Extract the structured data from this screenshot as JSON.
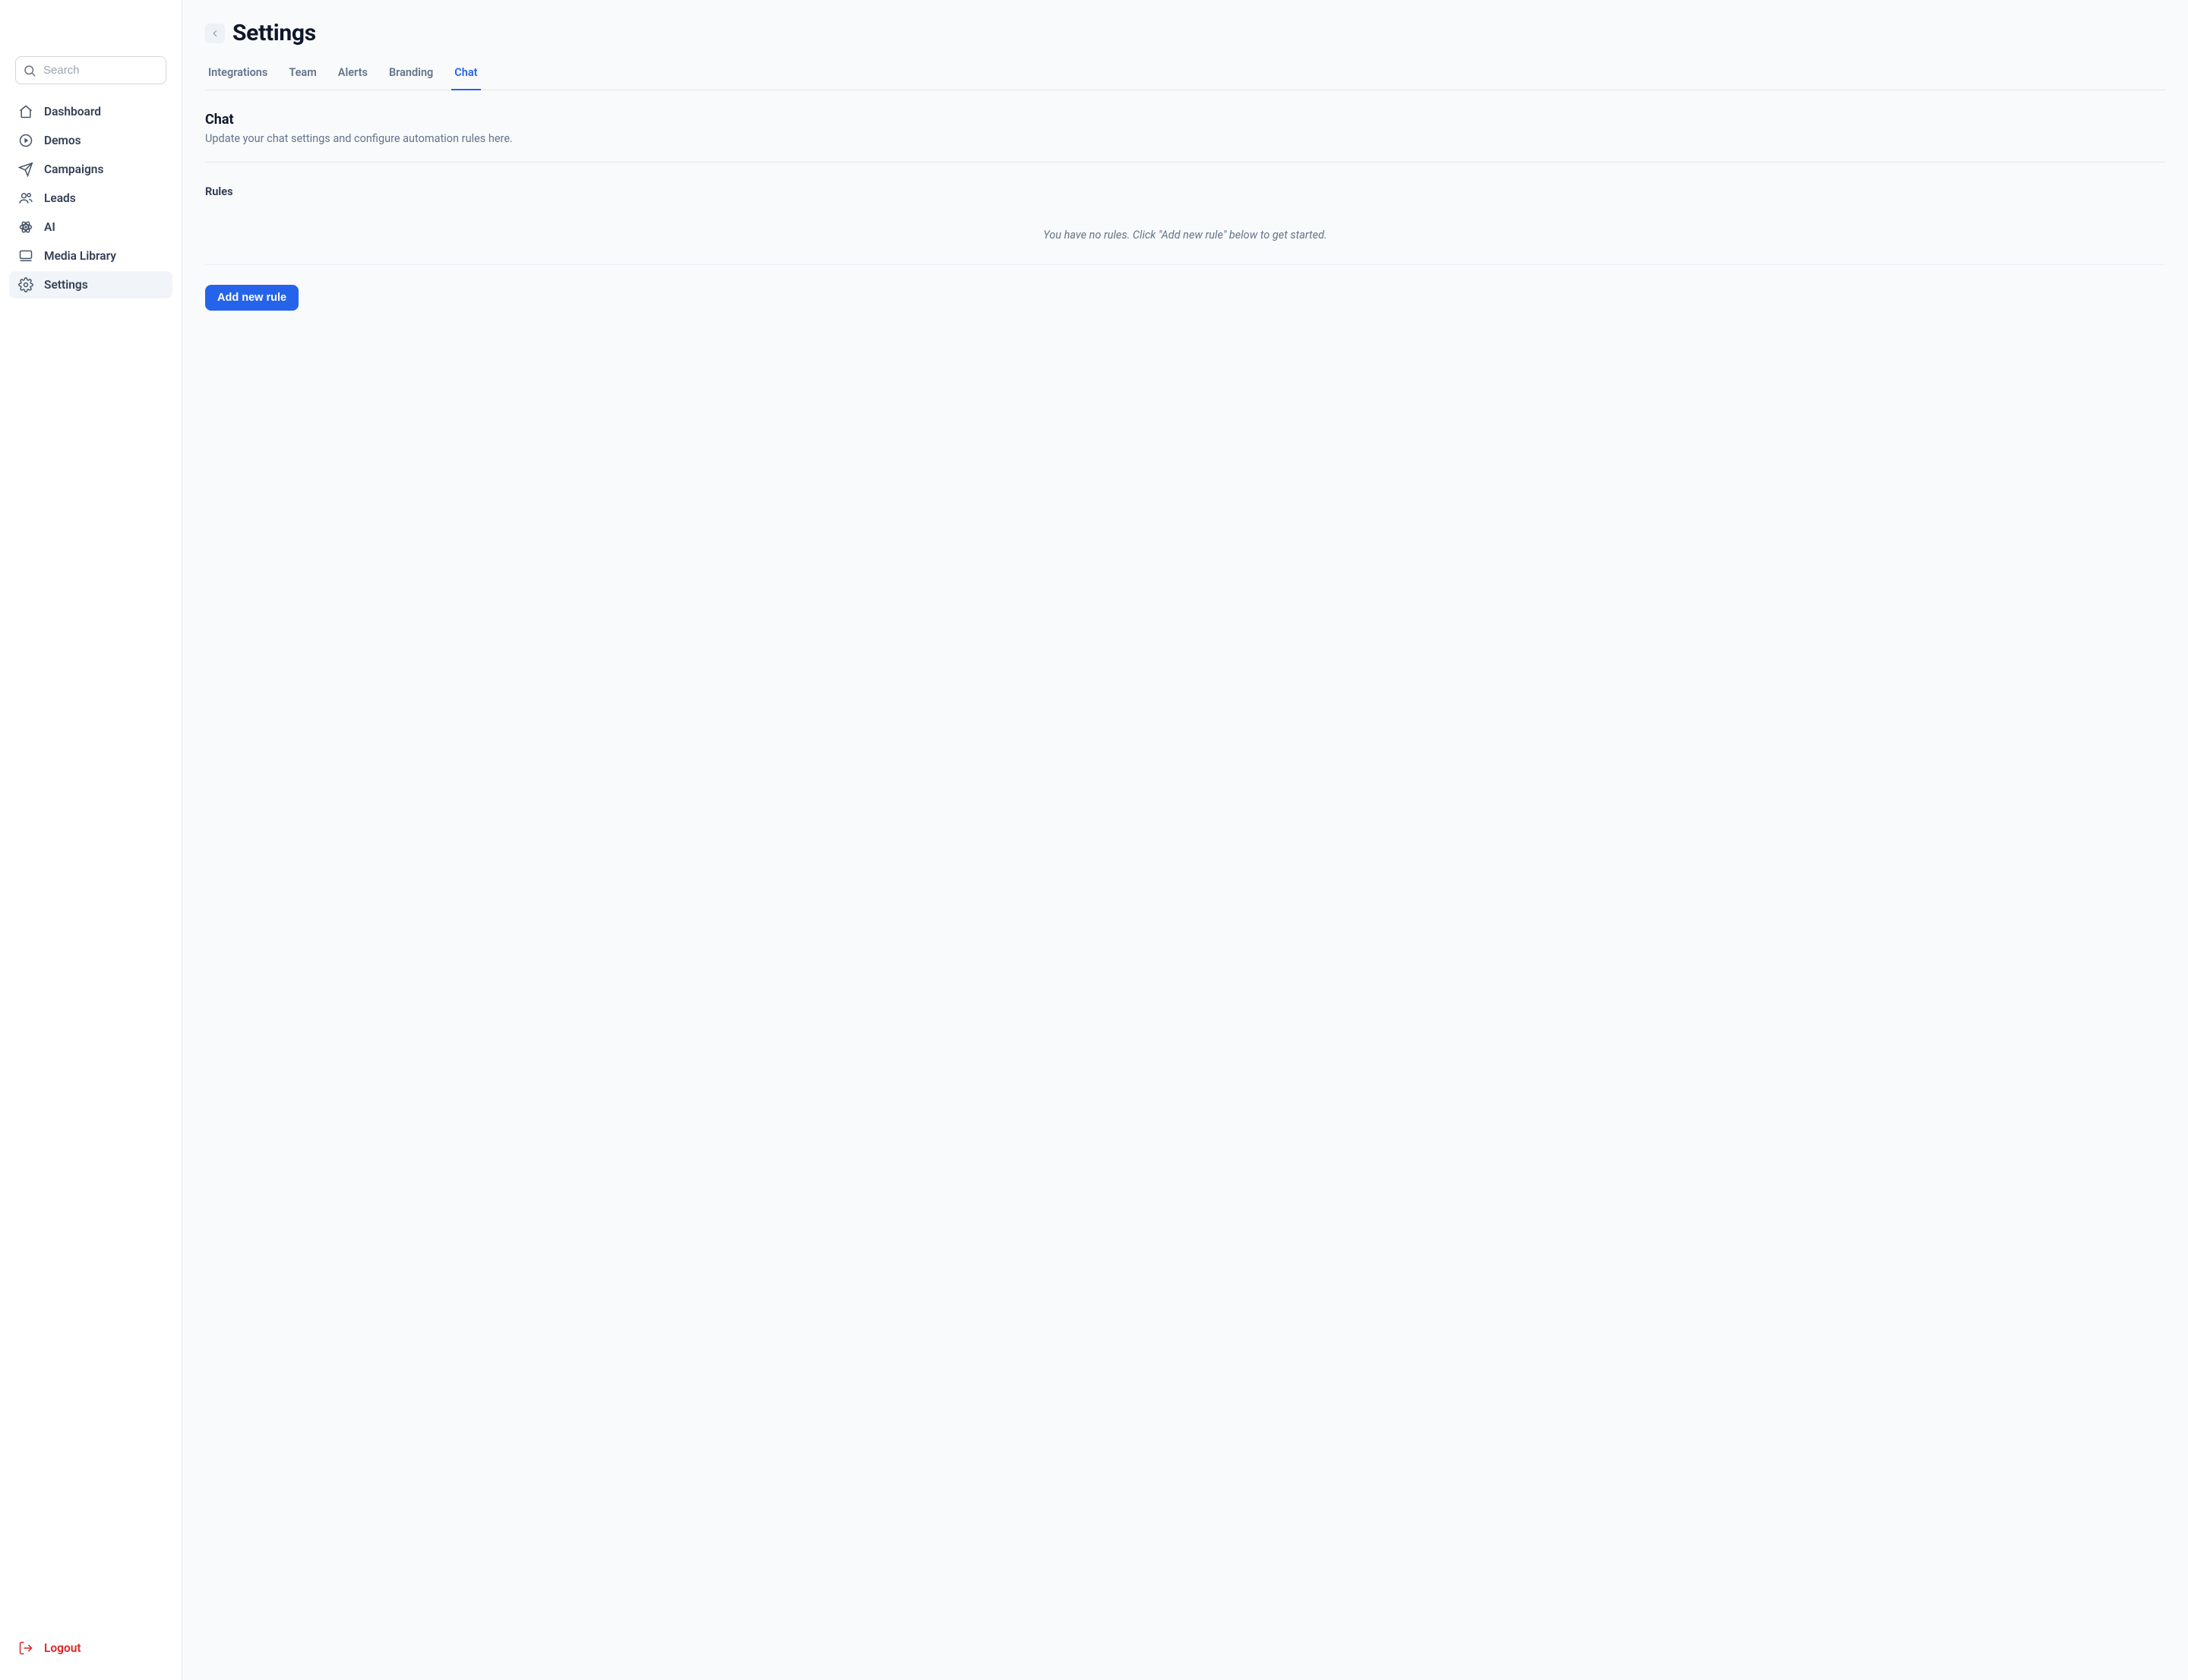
{
  "sidebar": {
    "search_placeholder": "Search",
    "items": [
      {
        "id": "dashboard",
        "label": "Dashboard",
        "icon": "home"
      },
      {
        "id": "demos",
        "label": "Demos",
        "icon": "play-circle"
      },
      {
        "id": "campaigns",
        "label": "Campaigns",
        "icon": "send"
      },
      {
        "id": "leads",
        "label": "Leads",
        "icon": "users"
      },
      {
        "id": "ai",
        "label": "AI",
        "icon": "atom"
      },
      {
        "id": "media",
        "label": "Media Library",
        "icon": "monitor"
      },
      {
        "id": "settings",
        "label": "Settings",
        "icon": "gear",
        "active": true
      }
    ],
    "logout_label": "Logout"
  },
  "page": {
    "title": "Settings",
    "tabs": [
      {
        "id": "integrations",
        "label": "Integrations"
      },
      {
        "id": "team",
        "label": "Team"
      },
      {
        "id": "alerts",
        "label": "Alerts"
      },
      {
        "id": "branding",
        "label": "Branding"
      },
      {
        "id": "chat",
        "label": "Chat",
        "active": true
      }
    ],
    "section": {
      "title": "Chat",
      "subtitle": "Update your chat settings and configure automation rules here."
    },
    "rules": {
      "heading": "Rules",
      "empty_text": "You have no rules. Click \"Add new rule\" below to get started.",
      "add_button": "Add new rule"
    }
  }
}
